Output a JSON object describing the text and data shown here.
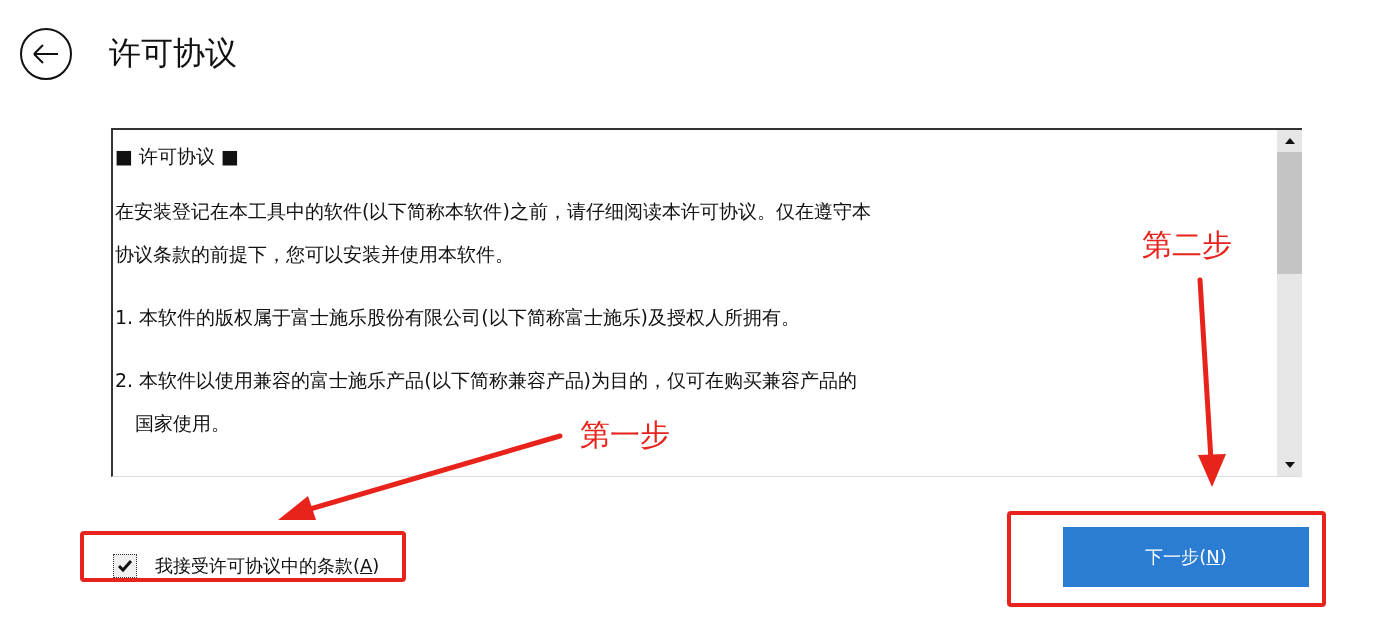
{
  "page": {
    "title": "许可协议"
  },
  "agreement": {
    "heading": "■ 许可协议 ■",
    "paragraphs": [
      {
        "kind": "plain",
        "lines": [
          "在安装登记在本工具中的软件(以下简称本软件)之前，请仔细阅读本许可协议。仅在遵守本",
          "协议条款的前提下，您可以安装并使用本软件。"
        ]
      },
      {
        "kind": "numbered",
        "lines": [
          "1. 本软件的版权属于富士施乐股份有限公司(以下简称富士施乐)及授权人所拥有。"
        ]
      },
      {
        "kind": "numbered",
        "lines": [
          "2. 本软件以使用兼容的富士施乐产品(以下简称兼容产品)为目的，仅可在购买兼容产品的",
          "国家使用。"
        ]
      }
    ]
  },
  "accept": {
    "label": "我接受许可协议中的条款(",
    "access_key": "A",
    "label_end": ")",
    "checked": true
  },
  "next_button": {
    "label": "下一步(",
    "access_key": "N",
    "label_end": ")"
  },
  "annotations": [
    {
      "kind": "label",
      "text": "第一步"
    },
    {
      "kind": "label",
      "text": "第二步"
    }
  ]
}
